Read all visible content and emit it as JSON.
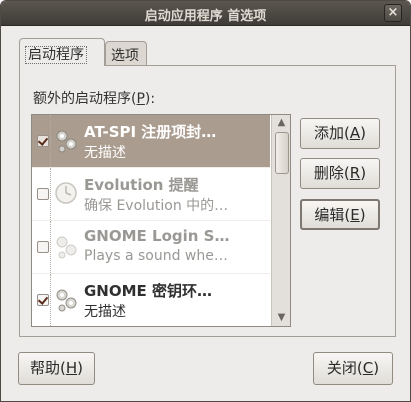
{
  "window": {
    "title": "启动应用程序 首选项",
    "close_label": "×"
  },
  "tabs": [
    {
      "label": "启动程序",
      "active": true
    },
    {
      "label": "选项",
      "active": false
    }
  ],
  "list_section": {
    "label_prefix": "额外的启动程序(",
    "mnemonic": "P",
    "label_suffix": "):"
  },
  "startup_items": [
    {
      "checked": true,
      "enabled": true,
      "selected": true,
      "name": "AT-SPI 注册项封…",
      "description": "无描述",
      "icon": "gears-icon"
    },
    {
      "checked": false,
      "enabled": false,
      "selected": false,
      "name": "Evolution 提醒",
      "description": "确保 Evolution 中的…",
      "icon": "clock-icon"
    },
    {
      "checked": false,
      "enabled": false,
      "selected": false,
      "name": "GNOME Login S…",
      "description": "Plays a sound whe…",
      "icon": "gears-icon"
    },
    {
      "checked": true,
      "enabled": true,
      "selected": false,
      "name": "GNOME 密钥环…",
      "description": "无描述",
      "icon": "gears-icon"
    }
  ],
  "side_buttons": {
    "add": {
      "label": "添加(",
      "mnemonic": "A",
      "suffix": ")"
    },
    "remove": {
      "label": "删除(",
      "mnemonic": "R",
      "suffix": ")"
    },
    "edit": {
      "label": "编辑(",
      "mnemonic": "E",
      "suffix": ")"
    }
  },
  "footer": {
    "help": {
      "label": "帮助(",
      "mnemonic": "H",
      "suffix": ")"
    },
    "close": {
      "label": "关闭(",
      "mnemonic": "C",
      "suffix": ")"
    }
  },
  "colors": {
    "titlebar": "#4b4741",
    "selection": "#aa9c8f",
    "window_bg": "#edeceb"
  }
}
